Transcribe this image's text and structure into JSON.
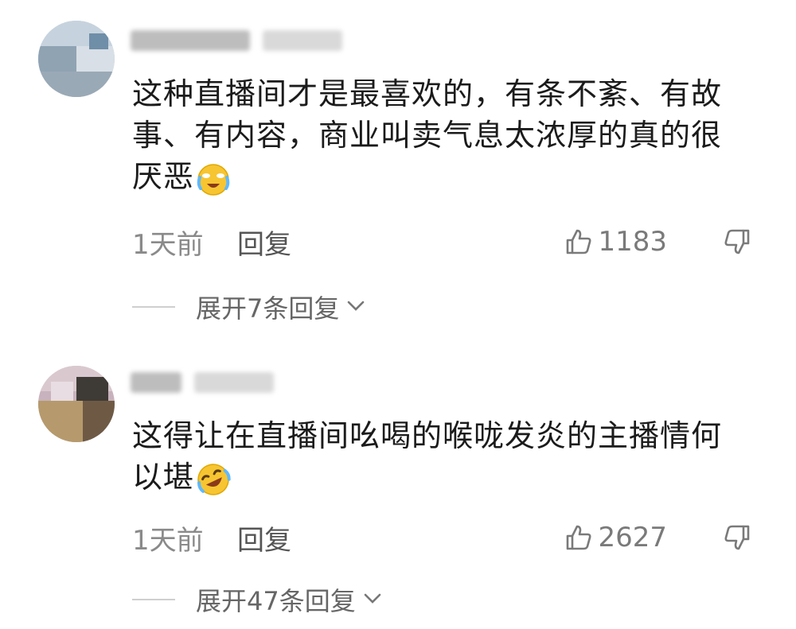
{
  "comments": [
    {
      "username": "",
      "body": "这种直播间才是最喜欢的，有条不紊、有故事、有内容，商业叫卖气息太浓厚的真的很厌恶",
      "emoji": "crying-laughing-face",
      "time": "1天前",
      "reply_label": "回复",
      "likes": "1183",
      "expand_label": "展开7条回复"
    },
    {
      "username": "",
      "body": "这得让在直播间吆喝的喉咙发炎的主播情何以堪",
      "emoji": "rolling-laughing-face",
      "time": "1天前",
      "reply_label": "回复",
      "likes": "2627",
      "expand_label": "展开47条回复"
    }
  ],
  "colors": {
    "text": "#1b1b1b",
    "meta": "#8a8a8a",
    "emoji_yellow": "#f7c531"
  }
}
